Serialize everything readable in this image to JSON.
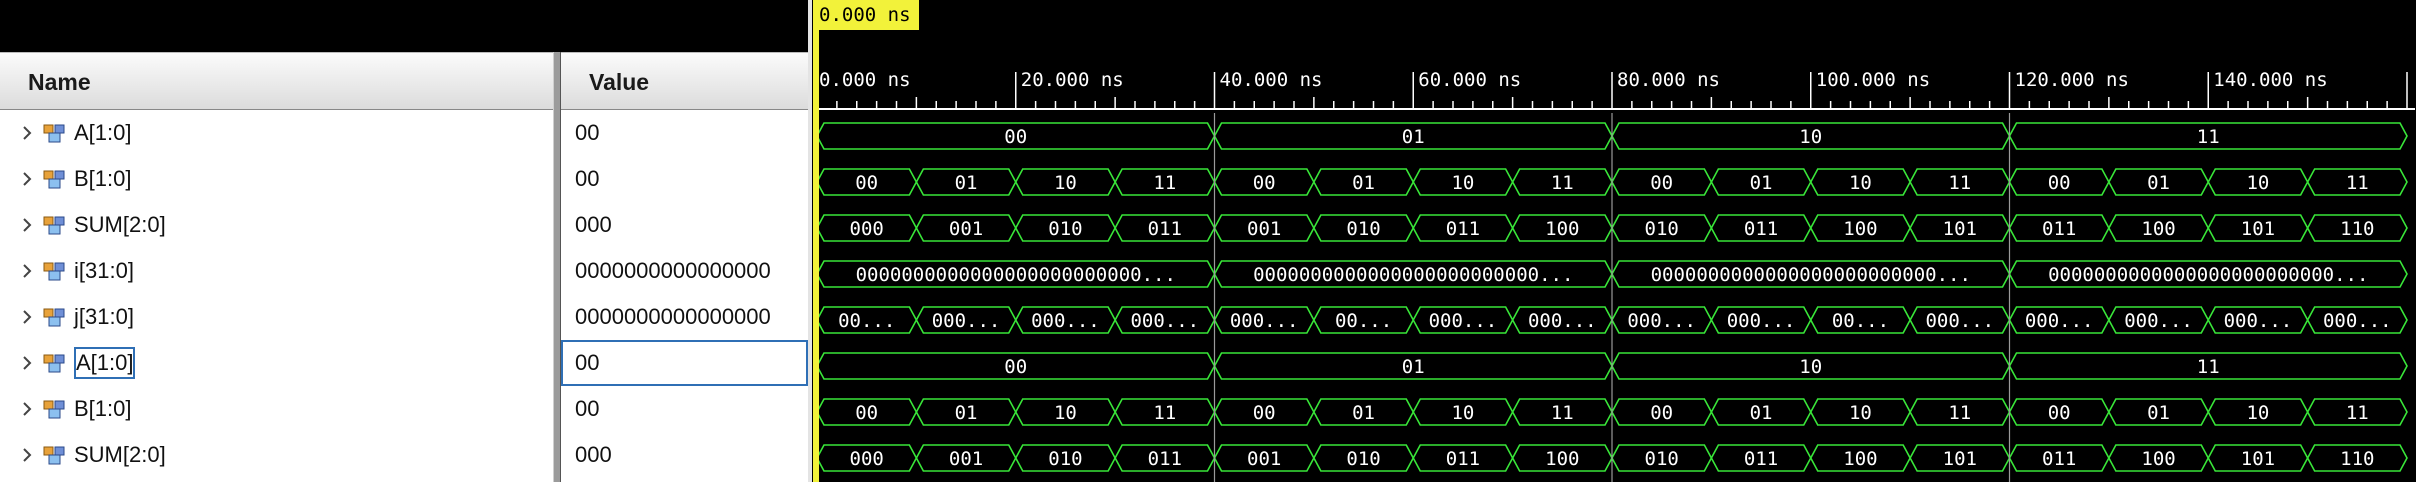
{
  "cursor": {
    "time_label": "0.000 ns"
  },
  "columns": {
    "name": "Name",
    "value": "Value"
  },
  "timeline": {
    "unit": "ns",
    "start": 0,
    "end": 160,
    "major_ticks": [
      "0.000 ns",
      "20.000 ns",
      "40.000 ns",
      "60.000 ns",
      "80.000 ns",
      "100.000 ns",
      "120.000 ns",
      "140.000 ns"
    ]
  },
  "signals": [
    {
      "name": "A[1:0]",
      "value": "00",
      "icon": "bus-signal-icon",
      "boxed": false,
      "segments": [
        [
          0,
          40,
          "00"
        ],
        [
          40,
          80,
          "01"
        ],
        [
          80,
          120,
          "10"
        ],
        [
          120,
          160,
          "11"
        ]
      ]
    },
    {
      "name": "B[1:0]",
      "value": "00",
      "icon": "bus-signal-icon",
      "boxed": false,
      "segments": [
        [
          0,
          10,
          "00"
        ],
        [
          10,
          20,
          "01"
        ],
        [
          20,
          30,
          "10"
        ],
        [
          30,
          40,
          "11"
        ],
        [
          40,
          50,
          "00"
        ],
        [
          50,
          60,
          "01"
        ],
        [
          60,
          70,
          "10"
        ],
        [
          70,
          80,
          "11"
        ],
        [
          80,
          90,
          "00"
        ],
        [
          90,
          100,
          "01"
        ],
        [
          100,
          110,
          "10"
        ],
        [
          110,
          120,
          "11"
        ],
        [
          120,
          130,
          "00"
        ],
        [
          130,
          140,
          "01"
        ],
        [
          140,
          150,
          "10"
        ],
        [
          150,
          160,
          "11"
        ]
      ]
    },
    {
      "name": "SUM[2:0]",
      "value": "000",
      "icon": "bus-signal-icon",
      "boxed": false,
      "segments": [
        [
          0,
          10,
          "000"
        ],
        [
          10,
          20,
          "001"
        ],
        [
          20,
          30,
          "010"
        ],
        [
          30,
          40,
          "011"
        ],
        [
          40,
          50,
          "001"
        ],
        [
          50,
          60,
          "010"
        ],
        [
          60,
          70,
          "011"
        ],
        [
          70,
          80,
          "100"
        ],
        [
          80,
          90,
          "010"
        ],
        [
          90,
          100,
          "011"
        ],
        [
          100,
          110,
          "100"
        ],
        [
          110,
          120,
          "101"
        ],
        [
          120,
          130,
          "011"
        ],
        [
          130,
          140,
          "100"
        ],
        [
          140,
          150,
          "101"
        ],
        [
          150,
          160,
          "110"
        ]
      ]
    },
    {
      "name": "i[31:0]",
      "value": "0000000000000000",
      "icon": "bus-signal-icon",
      "boxed": false,
      "segments": [
        [
          0,
          40,
          "0000000000000000000000000..."
        ],
        [
          40,
          80,
          "0000000000000000000000000..."
        ],
        [
          80,
          120,
          "0000000000000000000000000..."
        ],
        [
          120,
          160,
          "0000000000000000000000000..."
        ]
      ]
    },
    {
      "name": "j[31:0]",
      "value": "0000000000000000",
      "icon": "bus-signal-icon",
      "boxed": false,
      "segments": [
        [
          0,
          10,
          "00..."
        ],
        [
          10,
          20,
          "000..."
        ],
        [
          20,
          30,
          "000..."
        ],
        [
          30,
          40,
          "000..."
        ],
        [
          40,
          50,
          "000..."
        ],
        [
          50,
          60,
          "00..."
        ],
        [
          60,
          70,
          "000..."
        ],
        [
          70,
          80,
          "000..."
        ],
        [
          80,
          90,
          "000..."
        ],
        [
          90,
          100,
          "000..."
        ],
        [
          100,
          110,
          "00..."
        ],
        [
          110,
          120,
          "000..."
        ],
        [
          120,
          130,
          "000..."
        ],
        [
          130,
          140,
          "000..."
        ],
        [
          140,
          150,
          "000..."
        ],
        [
          150,
          160,
          "000..."
        ]
      ]
    },
    {
      "name": "A[1:0]",
      "value": "00",
      "icon": "bus-signal-icon",
      "boxed": true,
      "segments": [
        [
          0,
          40,
          "00"
        ],
        [
          40,
          80,
          "01"
        ],
        [
          80,
          120,
          "10"
        ],
        [
          120,
          160,
          "11"
        ]
      ]
    },
    {
      "name": "B[1:0]",
      "value": "00",
      "icon": "bus-signal-icon",
      "boxed": false,
      "segments": [
        [
          0,
          10,
          "00"
        ],
        [
          10,
          20,
          "01"
        ],
        [
          20,
          30,
          "10"
        ],
        [
          30,
          40,
          "11"
        ],
        [
          40,
          50,
          "00"
        ],
        [
          50,
          60,
          "01"
        ],
        [
          60,
          70,
          "10"
        ],
        [
          70,
          80,
          "11"
        ],
        [
          80,
          90,
          "00"
        ],
        [
          90,
          100,
          "01"
        ],
        [
          100,
          110,
          "10"
        ],
        [
          110,
          120,
          "11"
        ],
        [
          120,
          130,
          "00"
        ],
        [
          130,
          140,
          "01"
        ],
        [
          140,
          150,
          "10"
        ],
        [
          150,
          160,
          "11"
        ]
      ]
    },
    {
      "name": "SUM[2:0]",
      "value": "000",
      "icon": "bus-signal-icon",
      "boxed": false,
      "segments": [
        [
          0,
          10,
          "000"
        ],
        [
          10,
          20,
          "001"
        ],
        [
          20,
          30,
          "010"
        ],
        [
          30,
          40,
          "011"
        ],
        [
          40,
          50,
          "001"
        ],
        [
          50,
          60,
          "010"
        ],
        [
          60,
          70,
          "011"
        ],
        [
          70,
          80,
          "100"
        ],
        [
          80,
          90,
          "010"
        ],
        [
          90,
          100,
          "011"
        ],
        [
          100,
          110,
          "100"
        ],
        [
          110,
          120,
          "101"
        ],
        [
          120,
          130,
          "011"
        ],
        [
          130,
          140,
          "100"
        ],
        [
          140,
          150,
          "101"
        ],
        [
          150,
          160,
          "110"
        ]
      ]
    }
  ],
  "colors": {
    "wave": "#39e639",
    "cursor": "#f2f23a",
    "ruler": "#ffffff",
    "selection": "#2f6fb5",
    "background": "#000000"
  }
}
